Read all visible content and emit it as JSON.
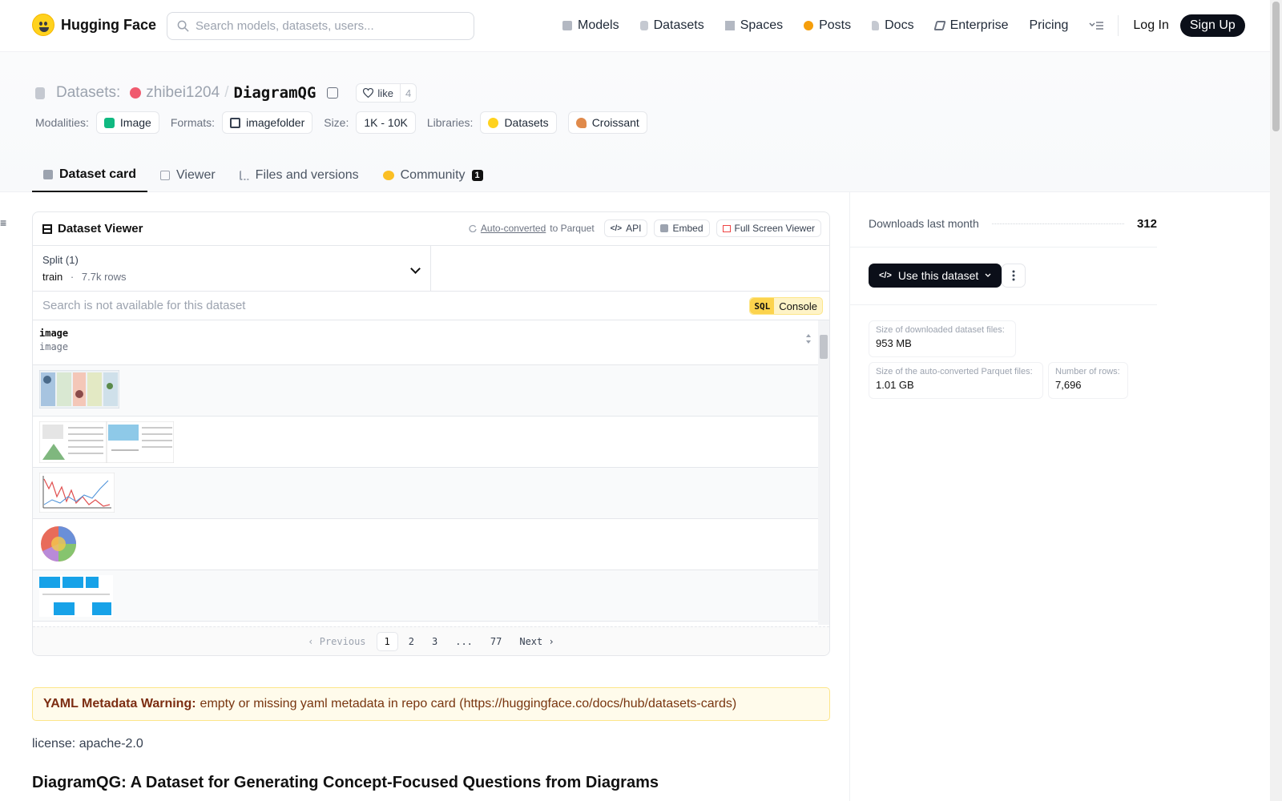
{
  "brand": {
    "name": "Hugging Face"
  },
  "search": {
    "placeholder": "Search models, datasets, users..."
  },
  "nav": {
    "items": [
      {
        "label": "Models",
        "icon": "models-icon",
        "color": "#9ca3af"
      },
      {
        "label": "Datasets",
        "icon": "datasets-icon",
        "color": "#9ca3af"
      },
      {
        "label": "Spaces",
        "icon": "spaces-icon",
        "color": "#9ca3af"
      },
      {
        "label": "Posts",
        "icon": "posts-icon",
        "color": "#f59e0b"
      },
      {
        "label": "Docs",
        "icon": "docs-icon",
        "color": "#9ca3af"
      },
      {
        "label": "Enterprise",
        "icon": "enterprise-icon",
        "color": "#6b7280"
      },
      {
        "label": "Pricing"
      }
    ],
    "login": "Log In",
    "signup": "Sign Up"
  },
  "repo": {
    "kind": "Datasets:",
    "user": "zhibei1204",
    "slash": "/",
    "name": "DiagramQG",
    "like_label": "like",
    "like_count": "4"
  },
  "meta": {
    "modalities_label": "Modalities:",
    "modality": "Image",
    "formats_label": "Formats:",
    "format": "imagefolder",
    "size_label": "Size:",
    "size": "1K - 10K",
    "libraries_label": "Libraries:",
    "libraries": [
      "Datasets",
      "Croissant"
    ]
  },
  "tabs": [
    {
      "label": "Dataset card",
      "active": true
    },
    {
      "label": "Viewer"
    },
    {
      "label": "Files and versions"
    },
    {
      "label": "Community",
      "badge": "1"
    }
  ],
  "viewer": {
    "title": "Dataset Viewer",
    "autoconv_link": "Auto-converted",
    "autoconv_rest": "to Parquet",
    "api": "API",
    "embed": "Embed",
    "fullscreen": "Full Screen Viewer",
    "split_label": "Split (1)",
    "split_value": "train",
    "split_sep": "·",
    "split_rows": "7.7k rows",
    "search_placeholder": "Search is not available for this dataset",
    "sql": "SQL",
    "console": "Console",
    "column_name": "image",
    "column_type": "image",
    "pager": {
      "previous": "Previous",
      "pages": [
        "1",
        "2",
        "3",
        "...",
        "77"
      ],
      "current": "1",
      "next": "Next"
    }
  },
  "card": {
    "warning_bold": "YAML Metadata Warning:",
    "warning_text": "empty or missing yaml metadata in repo card (",
    "warning_link": "https://huggingface.co/docs/hub/datasets-cards",
    "warning_close": ")",
    "license": "license: apache-2.0",
    "heading": "DiagramQG: A Dataset for Generating Concept-Focused Questions from Diagrams"
  },
  "sidebar": {
    "downloads_label": "Downloads last month",
    "downloads_value": "312",
    "use_button": "Use this dataset",
    "stats": [
      {
        "label": "Size of downloaded dataset files:",
        "value": "953 MB"
      },
      {
        "label": "Size of the auto-converted Parquet files:",
        "value": "1.01 GB"
      },
      {
        "label": "Number of rows:",
        "value": "7,696"
      }
    ]
  },
  "colors": {
    "accent": "#0b0f19",
    "brand_yellow": "#ffd21e",
    "warning_bg": "#fffbeb"
  }
}
